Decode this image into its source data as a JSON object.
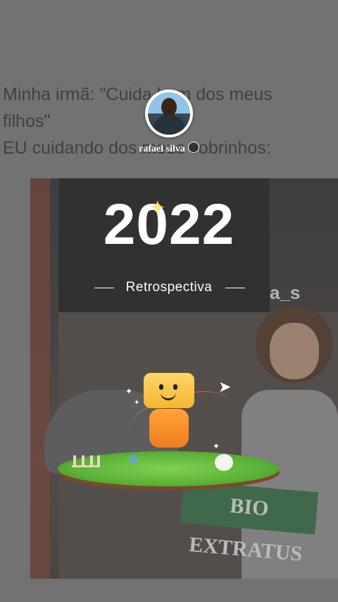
{
  "tweet": {
    "line1": "Minha irmã: \"Cuida bem dos meus",
    "line2": "filhos\"",
    "line3": "EU cuidando dos meus sobrinhos:"
  },
  "profile": {
    "username": "rafael silva"
  },
  "story": {
    "year": "2022",
    "subtitle": "Retrospectiva"
  },
  "meme": {
    "watermark": "a_s",
    "shop_sign": "BIO EXTRATUS"
  },
  "colors": {
    "overlay": "#646464",
    "title": "#ffffff",
    "sparkle": "#ffe27a",
    "sign_bg": "#2d6b3e"
  },
  "icons": [
    "sparkle-icon",
    "paper-plane-icon",
    "emoji-icon"
  ]
}
